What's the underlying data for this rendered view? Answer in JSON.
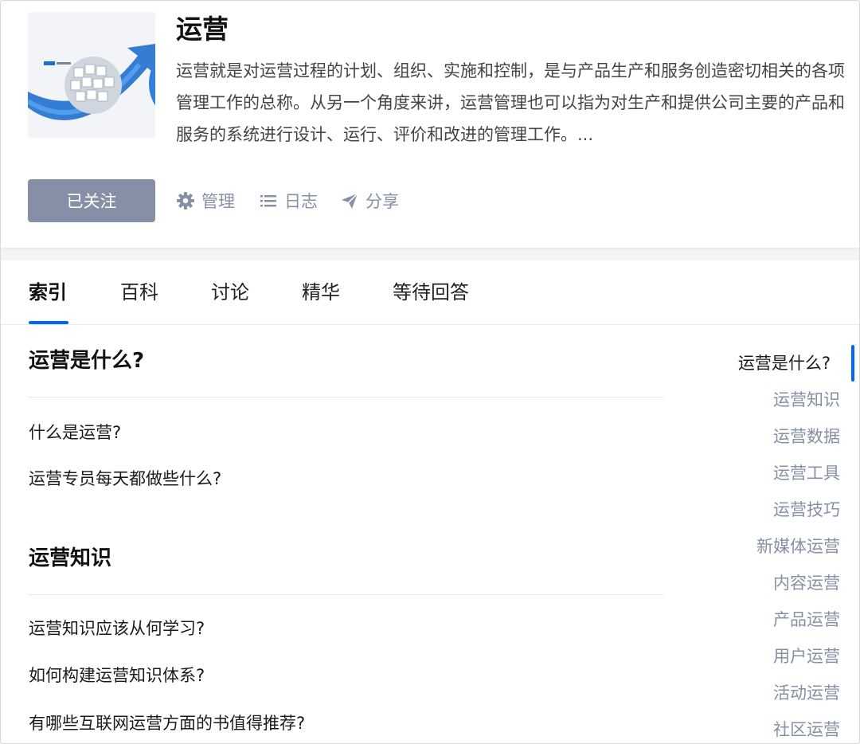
{
  "topic": {
    "title": "运营",
    "description": "运营就是对运营过程的计划、组织、实施和控制，是与产品生产和服务创造密切相关的各项管理工作的总称。从另一个角度来讲，运营管理也可以指为对生产和提供公司主要的产品和服务的系统进行设计、运行、评价和改进的管理工作。...",
    "follow_label": "已关注",
    "actions": {
      "manage": "管理",
      "log": "日志",
      "share": "分享"
    }
  },
  "tabs": [
    "索引",
    "百科",
    "讨论",
    "精华",
    "等待回答"
  ],
  "active_tab": "索引",
  "sections": [
    {
      "title": "运营是什么?",
      "questions": [
        "什么是运营?",
        "运营专员每天都做些什么?"
      ]
    },
    {
      "title": "运营知识",
      "questions": [
        "运营知识应该从何学习?",
        "如何构建运营知识体系?",
        "有哪些互联网运营方面的书值得推荐?"
      ]
    }
  ],
  "toc": [
    "运营是什么?",
    "运营知识",
    "运营数据",
    "运营工具",
    "运营技巧",
    "新媒体运营",
    "内容运营",
    "产品运营",
    "用户运营",
    "活动运营",
    "社区运营"
  ],
  "colors": {
    "accent": "#0066ff",
    "muted": "#8590a6",
    "follow_button": "#8590a6"
  },
  "icons": {
    "manage": "gear-icon",
    "log": "list-icon",
    "share": "paper-plane-icon"
  }
}
